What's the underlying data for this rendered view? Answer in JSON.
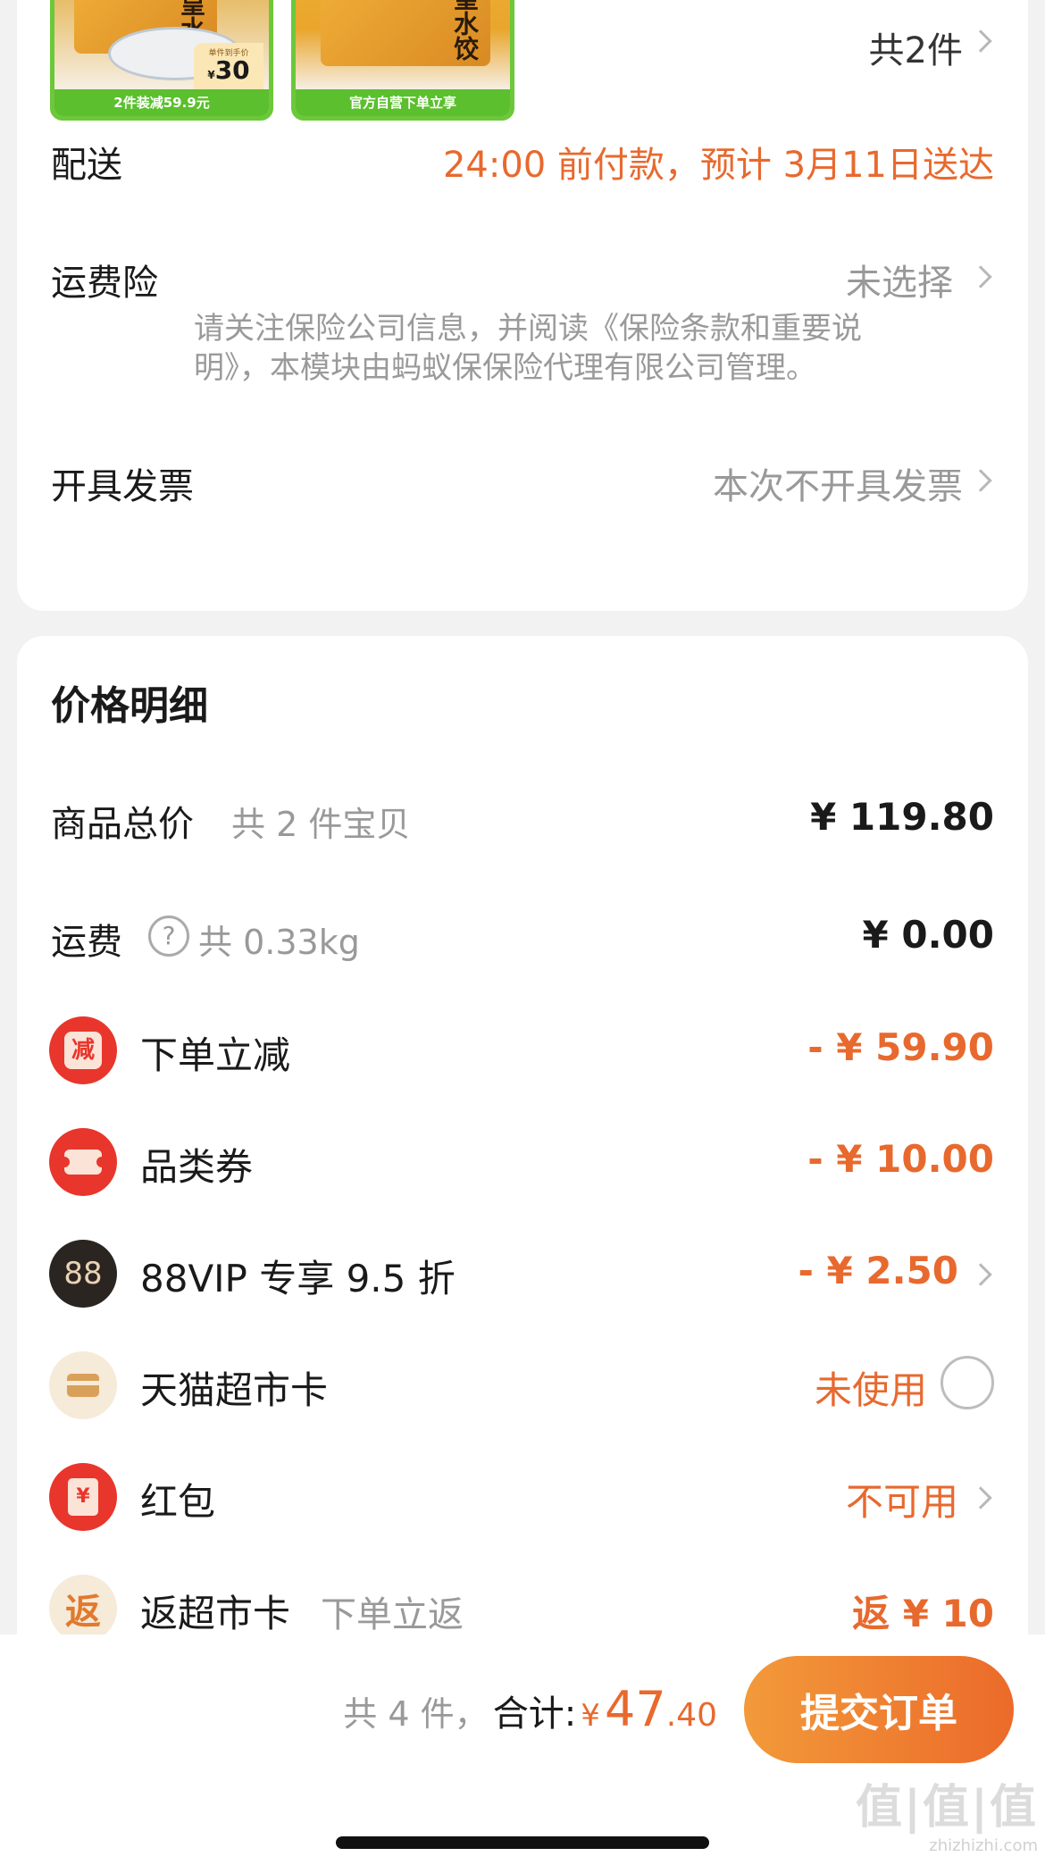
{
  "order": {
    "items_count_label": "共2件",
    "product1": {
      "title": "虾皇水饺",
      "strip": "2件装减59.9元",
      "tag_top": "单件到手价",
      "tag_currency": "¥",
      "tag_price": "30"
    },
    "product2": {
      "title": "虾皇水饺",
      "strip": "官方自营下单立享"
    },
    "delivery": {
      "label": "配送",
      "value": "24:00 前付款，预计 3月11日送达"
    },
    "insurance": {
      "label": "运费险",
      "value": "未选择",
      "note_line1": "请关注保险公司信息，并阅读《保险条款和重要说",
      "note_line2": "明》，本模块由蚂蚁保保险代理有限公司管理。"
    },
    "invoice": {
      "label": "开具发票",
      "value": "本次不开具发票"
    }
  },
  "price": {
    "title": "价格明细",
    "goods_total": {
      "label": "商品总价",
      "sub": "共 2 件宝贝",
      "value": "¥ 119.80"
    },
    "shipping": {
      "label": "运费",
      "help_glyph": "?",
      "sub": "共 0.33kg",
      "value": "¥ 0.00"
    },
    "discounts": [
      {
        "icon": "reduce-icon",
        "glyph": "减",
        "label": "下单立减",
        "value": "- ¥ 59.90"
      },
      {
        "icon": "coupon-icon",
        "glyph": "",
        "label": "品类券",
        "value": "- ¥ 10.00"
      },
      {
        "icon": "vip88-icon",
        "glyph": "88",
        "label": "88VIP 专享 9.5 折",
        "value": "- ¥ 2.50"
      },
      {
        "icon": "card-icon",
        "glyph": "",
        "label": "天猫超市卡",
        "value": "未使用"
      },
      {
        "icon": "red-packet-icon",
        "glyph": "¥",
        "label": "红包",
        "value": "不可用"
      },
      {
        "icon": "rebate-icon",
        "glyph": "返",
        "label": "返超市卡",
        "sub": "下单立返",
        "value": "返 ¥ 10"
      }
    ]
  },
  "footer": {
    "count": "共 4 件，",
    "total_label": "合计:",
    "currency": "¥",
    "total_int": "47",
    "total_dec": ".40",
    "submit_label": "提交订单"
  },
  "watermark": {
    "text": "值|值|值",
    "site": "zhizhizhi.com"
  },
  "colors": {
    "accent": "#e8692e",
    "brand_green": "#6cc83a",
    "vip_dark": "#2b2522",
    "red": "#e8362c"
  }
}
